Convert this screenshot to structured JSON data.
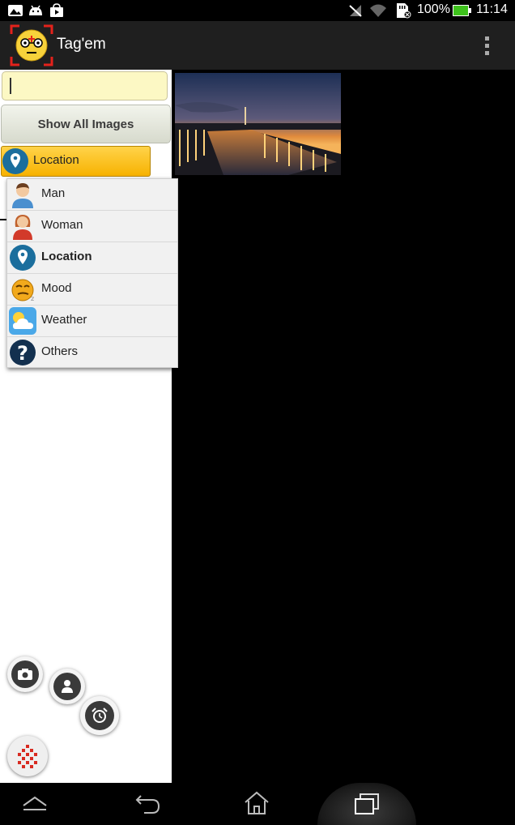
{
  "status_bar": {
    "battery": "100%",
    "time": "11:14",
    "icons": [
      "gallery-icon",
      "android-icon",
      "store-icon",
      "signal-off-icon",
      "wifi-icon",
      "sd-card-icon",
      "battery-icon"
    ]
  },
  "action_bar": {
    "app_title": "Tag'em",
    "icons": [
      "app-logo-icon",
      "overflow-menu-icon"
    ]
  },
  "sidebar": {
    "search_value": "",
    "show_all_label": "Show All Images",
    "spinner_selected": "Location",
    "dropdown_items": [
      {
        "label": "Man",
        "icon": "man-icon"
      },
      {
        "label": "Woman",
        "icon": "woman-icon"
      },
      {
        "label": "Location",
        "icon": "location-icon"
      },
      {
        "label": "Mood",
        "icon": "mood-icon"
      },
      {
        "label": "Weather",
        "icon": "weather-icon"
      },
      {
        "label": "Others",
        "icon": "question-icon"
      }
    ]
  },
  "fab_icons": [
    "camera-icon",
    "person-icon",
    "alarm-icon",
    "grid-menu-icon"
  ],
  "nav_bar": {
    "icons": [
      "nav-up-icon",
      "back-icon",
      "home-icon",
      "recent-apps-icon"
    ]
  },
  "colors": {
    "spinner": "#f7b200",
    "search_bg": "#fcf8c4",
    "action_bar": "#1f1f1f"
  }
}
